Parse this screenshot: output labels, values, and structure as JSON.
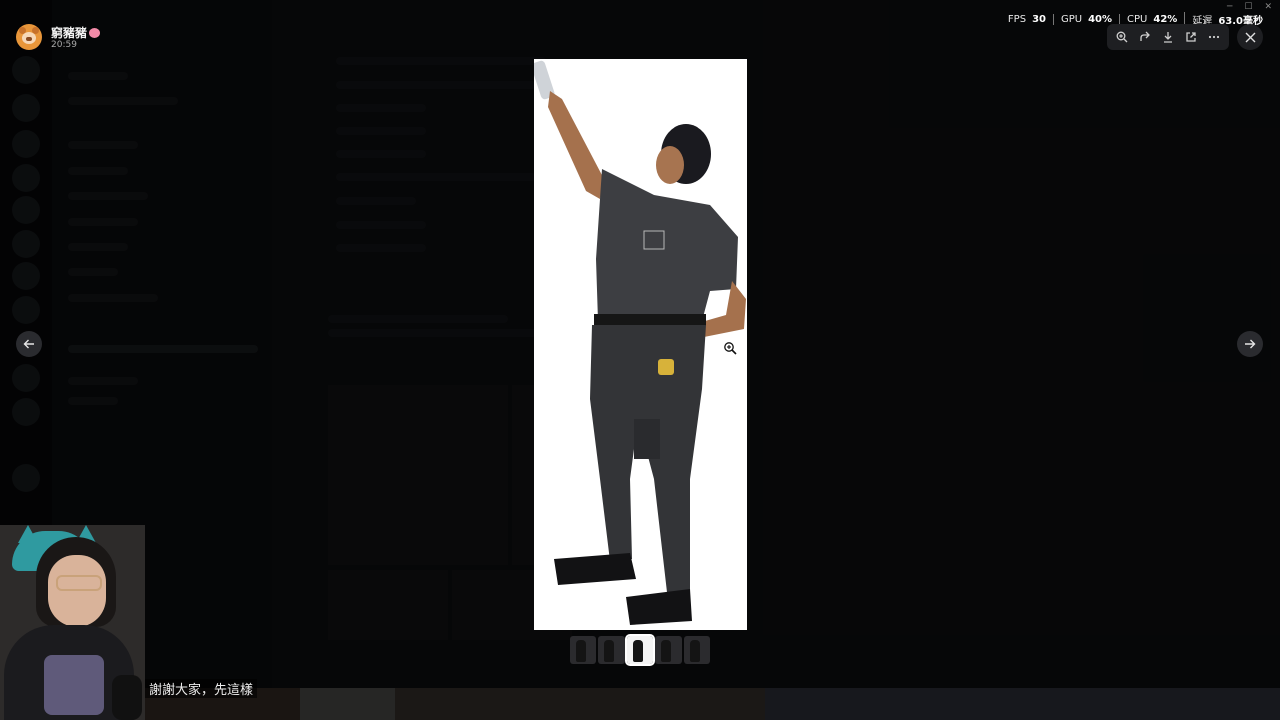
{
  "viewer": {
    "author": {
      "name": "窮豬豬",
      "time": "20:59"
    },
    "stats": [
      {
        "label": "FPS",
        "value": "30"
      },
      {
        "label": "GPU",
        "value": "40%"
      },
      {
        "label": "CPU",
        "value": "42%"
      },
      {
        "label": "延遲",
        "value": "63.0毫秒"
      }
    ],
    "toolbar": [
      "zoom-in",
      "forward",
      "download",
      "open-external",
      "more"
    ],
    "close_label": "×",
    "prev_label": "←",
    "next_label": "→",
    "thumbnail_count": 5,
    "active_thumbnail": 3
  },
  "stream": {
    "caption": "謝謝大家，先這樣"
  },
  "colors": {
    "backdrop": "#000000",
    "toolbar_bg": "#1e1f22",
    "image_bg": "#ffffff"
  }
}
